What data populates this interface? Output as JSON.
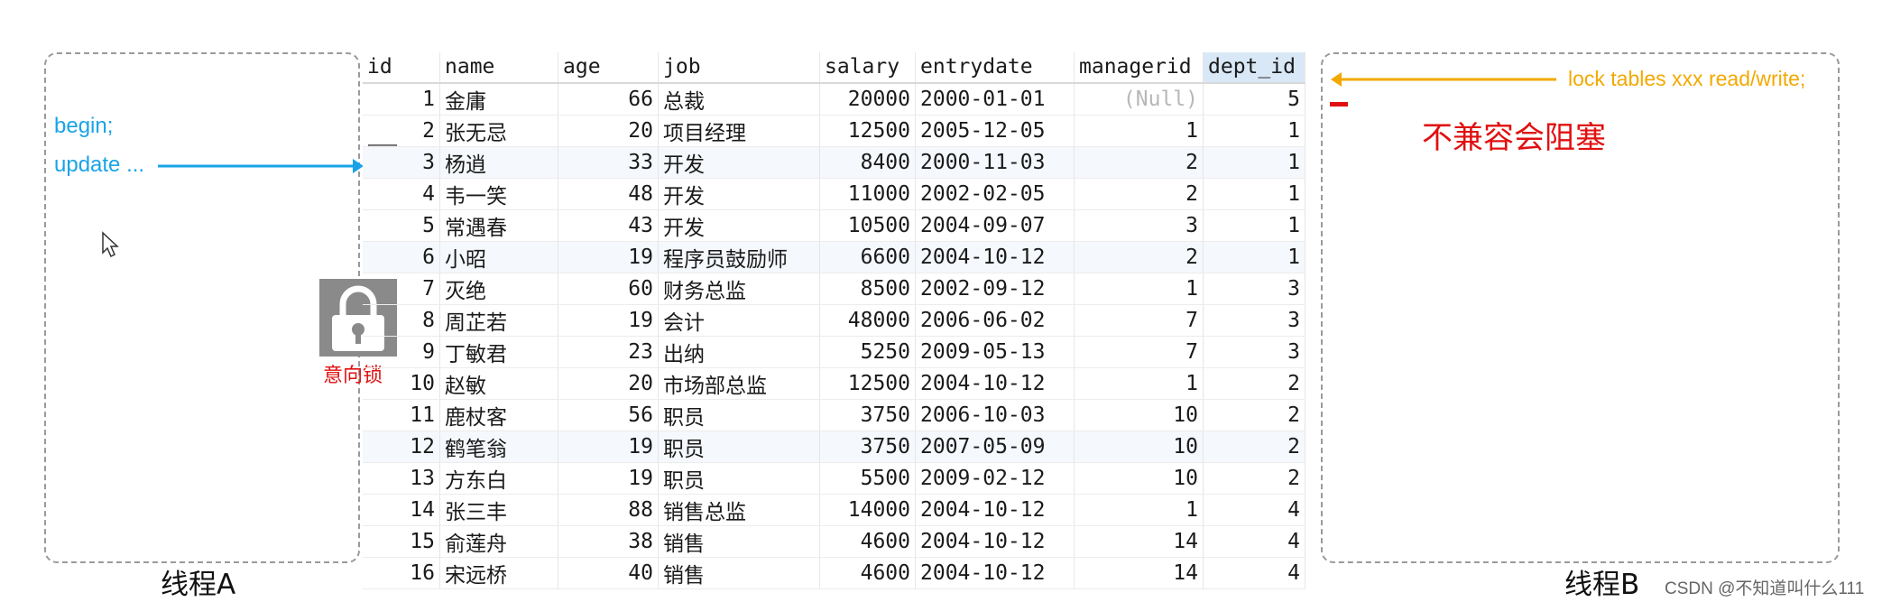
{
  "threadA": {
    "label": "线程A",
    "lines": [
      "begin;",
      "update ..."
    ]
  },
  "threadB": {
    "label": "线程B",
    "annotation": "lock tables xxx read/write;",
    "status": "不兼容会阻塞"
  },
  "intent_lock": {
    "label": "意向锁",
    "icon": "padlock-icon"
  },
  "row_lock_icon": "padlock-icon",
  "watermark": "CSDN @不知道叫什么111",
  "colors": {
    "cyan": "#1aa3e8",
    "orange": "#f2a900",
    "red": "#e01010",
    "lock_gray": "#8a8a8a"
  },
  "table": {
    "columns": [
      "id",
      "name",
      "age",
      "job",
      "salary",
      "entrydate",
      "managerid",
      "dept_id"
    ],
    "rows": [
      [
        "1",
        "金庸",
        "66",
        "总裁",
        "20000",
        "2000-01-01",
        "(Null)",
        "5"
      ],
      [
        "2",
        "张无忌",
        "20",
        "项目经理",
        "12500",
        "2005-12-05",
        "1",
        "1"
      ],
      [
        "3",
        "杨逍",
        "33",
        "开发",
        "8400",
        "2000-11-03",
        "2",
        "1"
      ],
      [
        "4",
        "韦一笑",
        "48",
        "开发",
        "11000",
        "2002-02-05",
        "2",
        "1"
      ],
      [
        "5",
        "常遇春",
        "43",
        "开发",
        "10500",
        "2004-09-07",
        "3",
        "1"
      ],
      [
        "6",
        "小昭",
        "19",
        "程序员鼓励师",
        "6600",
        "2004-10-12",
        "2",
        "1"
      ],
      [
        "7",
        "灭绝",
        "60",
        "财务总监",
        "8500",
        "2002-09-12",
        "1",
        "3"
      ],
      [
        "8",
        "周芷若",
        "19",
        "会计",
        "48000",
        "2006-06-02",
        "7",
        "3"
      ],
      [
        "9",
        "丁敏君",
        "23",
        "出纳",
        "5250",
        "2009-05-13",
        "7",
        "3"
      ],
      [
        "10",
        "赵敏",
        "20",
        "市场部总监",
        "12500",
        "2004-10-12",
        "1",
        "2"
      ],
      [
        "11",
        "鹿杖客",
        "56",
        "职员",
        "3750",
        "2006-10-03",
        "10",
        "2"
      ],
      [
        "12",
        "鹤笔翁",
        "19",
        "职员",
        "3750",
        "2007-05-09",
        "10",
        "2"
      ],
      [
        "13",
        "方东白",
        "19",
        "职员",
        "5500",
        "2009-02-12",
        "10",
        "2"
      ],
      [
        "14",
        "张三丰",
        "88",
        "销售总监",
        "14000",
        "2004-10-12",
        "1",
        "4"
      ],
      [
        "15",
        "俞莲舟",
        "38",
        "销售",
        "4600",
        "2004-10-12",
        "14",
        "4"
      ],
      [
        "16",
        "宋远桥",
        "40",
        "销售",
        "4600",
        "2004-10-12",
        "14",
        "4"
      ]
    ]
  }
}
